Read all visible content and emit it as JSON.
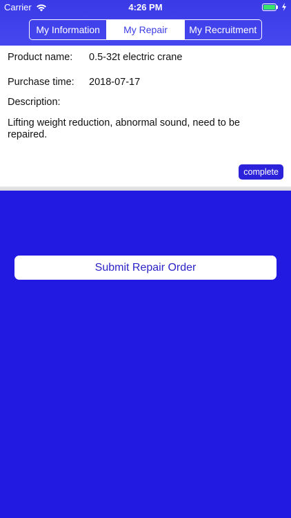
{
  "status_bar": {
    "carrier": "Carrier",
    "time": "4:26 PM"
  },
  "tabs": [
    {
      "label": "My Information",
      "active": false
    },
    {
      "label": "My Repair",
      "active": true
    },
    {
      "label": "My Recruitment",
      "active": false
    }
  ],
  "repair_order": {
    "product_label": "Product name:",
    "product_value": "0.5-32t electric crane",
    "purchase_label": "Purchase time:",
    "purchase_value": "2018-07-17",
    "description_label": "Description:",
    "description_value": "Lifting weight reduction, abnormal sound, need to be repaired.",
    "status": "complete"
  },
  "submit_button_label": "Submit Repair Order",
  "colors": {
    "brand": "#221ae0",
    "header": "#3f3fea",
    "badge": "#2b22d9",
    "battery": "#38e46c"
  }
}
